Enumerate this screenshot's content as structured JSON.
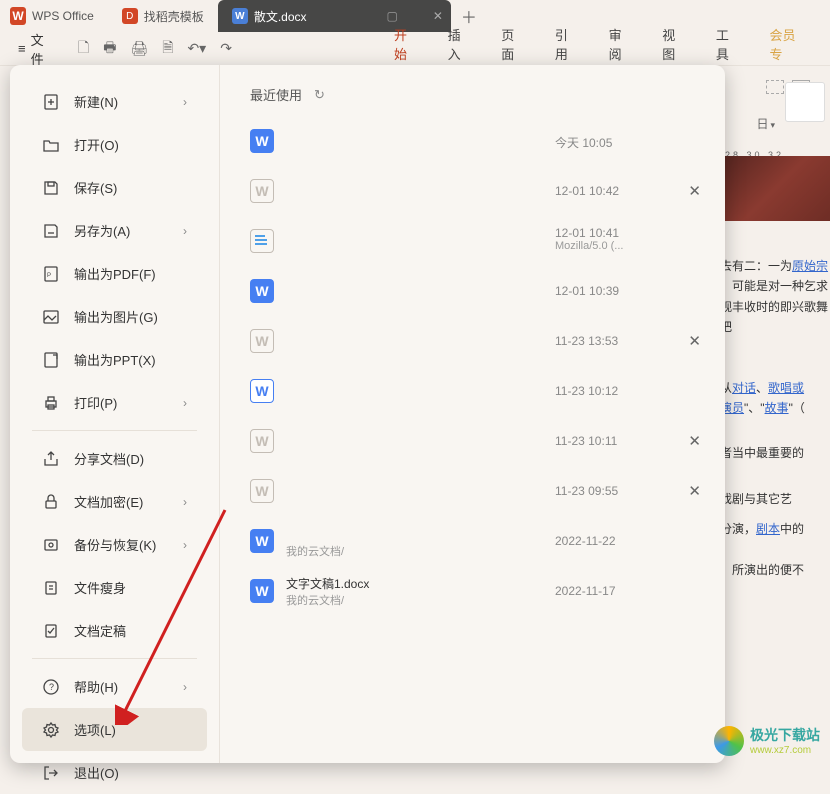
{
  "appTabs": [
    {
      "id": "wps",
      "label": "WPS Office",
      "iconType": "wps"
    },
    {
      "id": "docer",
      "label": "找稻壳模板",
      "iconType": "d-red"
    },
    {
      "id": "active",
      "label": "散文.docx",
      "iconType": "doc-blue",
      "active": true
    }
  ],
  "toolbar": {
    "fileLabel": "文件"
  },
  "menuTabs": [
    "开始",
    "插入",
    "页面",
    "引用",
    "审阅",
    "视图",
    "工具",
    "会员专"
  ],
  "activeMenuTab": "开始",
  "fileMenu": {
    "items": [
      {
        "id": "new",
        "label": "新建(N)",
        "hasArrow": true
      },
      {
        "id": "open",
        "label": "打开(O)"
      },
      {
        "id": "save",
        "label": "保存(S)"
      },
      {
        "id": "saveas",
        "label": "另存为(A)",
        "hasArrow": true
      },
      {
        "id": "pdf",
        "label": "输出为PDF(F)"
      },
      {
        "id": "pic",
        "label": "输出为图片(G)"
      },
      {
        "id": "ppt",
        "label": "输出为PPT(X)"
      },
      {
        "id": "print",
        "label": "打印(P)",
        "hasArrow": true
      },
      {
        "id": "share",
        "label": "分享文档(D)"
      },
      {
        "id": "encrypt",
        "label": "文档加密(E)",
        "hasArrow": true
      },
      {
        "id": "backup",
        "label": "备份与恢复(K)",
        "hasArrow": true
      },
      {
        "id": "slim",
        "label": "文件瘦身"
      },
      {
        "id": "final",
        "label": "文档定稿"
      },
      {
        "id": "help",
        "label": "帮助(H)",
        "hasArrow": true
      },
      {
        "id": "options",
        "label": "选项(L)",
        "selected": true
      },
      {
        "id": "exit",
        "label": "退出(O)"
      }
    ],
    "recentHeader": "最近使用",
    "recentFiles": [
      {
        "icon": "blue",
        "time": "今天 10:05",
        "blur": true
      },
      {
        "icon": "grey",
        "time": "12-01 10:42",
        "blur": true,
        "close": true
      },
      {
        "icon": "text",
        "time": "12-01 10:41",
        "time2": "Mozilla/5.0 (...",
        "blur": true
      },
      {
        "icon": "blue",
        "time": "12-01 10:39",
        "blur": true
      },
      {
        "icon": "grey",
        "time": "11-23 13:53",
        "blur": true,
        "close": true
      },
      {
        "icon": "outline",
        "time": "11-23 10:12",
        "blur": true
      },
      {
        "icon": "grey",
        "time": "11-23 10:11",
        "blur": true,
        "close": true
      },
      {
        "icon": "grey",
        "time": "11-23 09:55",
        "blur": true,
        "close": true
      },
      {
        "icon": "blue",
        "time": "2022-11-22",
        "path": "我的云文档/",
        "blur": true
      },
      {
        "icon": "blue",
        "name": "文字文稿1.docx",
        "path": "我的云文档/",
        "time": "2022-11-17"
      }
    ]
  },
  "bgText": {
    "ruler": "28   30   32",
    "l1": "去有二：一为",
    "l1link": "原始宗",
    "l2": "可能是对一种乞求",
    "l3": "观丰收时的即兴歌舞",
    "l4": "把",
    "l5": "从",
    "l5links": [
      "对话",
      "歌唱或"
    ],
    "l6links": [
      "演员",
      "故事"
    ],
    "l6suffix": "（",
    "l7": "者当中最重要的",
    "l8": "戏剧与其它艺",
    "l9": "分演，",
    "l9link": "剧本",
    "l9suffix": "中的",
    "l10": "，所演出的便不"
  },
  "rightTools": {
    "boxLabel": "日"
  },
  "watermark": {
    "title": "极光下载站",
    "sub": "www.xz7.com"
  }
}
